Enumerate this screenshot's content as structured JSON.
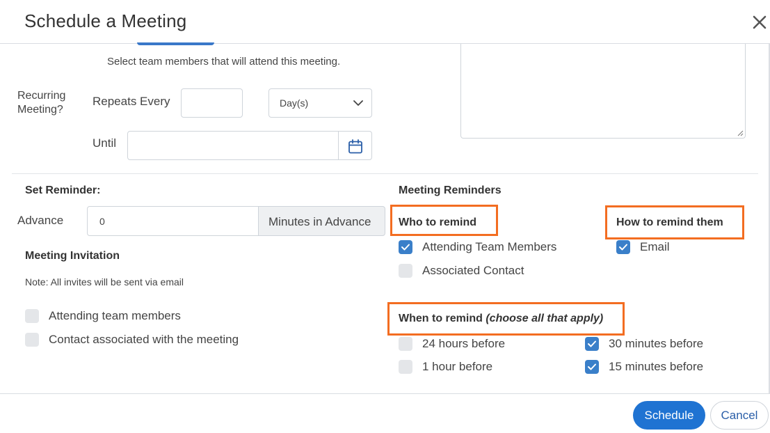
{
  "dialog": {
    "title": "Schedule a Meeting"
  },
  "attendees": {
    "hint": "Select team members that will attend this meeting."
  },
  "recurring": {
    "label": "Recurring Meeting?",
    "label_line1": "Recurring",
    "label_line2": "Meeting?",
    "repeats_label": "Repeats Every",
    "repeats_value": "",
    "unit_value": "Day(s)",
    "until_label": "Until",
    "until_value": ""
  },
  "reminder": {
    "title": "Set Reminder:",
    "advance_label": "Advance",
    "advance_value": "0",
    "advance_unit": "Minutes in Advance"
  },
  "invitation": {
    "title": "Meeting Invitation",
    "note": "Note: All invites will be sent via email",
    "options": [
      {
        "label": "Attending team members",
        "checked": false
      },
      {
        "label": "Contact associated with the meeting",
        "checked": false
      }
    ]
  },
  "meeting_reminders": {
    "title": "Meeting Reminders",
    "who_label": "Who to remind",
    "who_options": [
      {
        "label": "Attending Team Members",
        "checked": true
      },
      {
        "label": "Associated Contact",
        "checked": false
      }
    ],
    "how_label": "How to remind them",
    "how_options": [
      {
        "label": "Email",
        "checked": true
      }
    ],
    "when_label": "When to remind",
    "when_hint": "(choose all that apply)",
    "when_options": [
      {
        "label": "24 hours before",
        "checked": false
      },
      {
        "label": "1 hour before",
        "checked": false
      },
      {
        "label": "30 minutes before",
        "checked": true
      },
      {
        "label": "15 minutes before",
        "checked": true
      }
    ]
  },
  "footer": {
    "schedule_label": "Schedule",
    "cancel_label": "Cancel"
  },
  "colors": {
    "primary": "#1f73d2",
    "checkbox_checked": "#3a7fc9",
    "highlight": "#f36d21"
  },
  "icons": {
    "close": "close-icon",
    "calendar": "calendar-icon",
    "dropdown": "chevron-down-icon",
    "check": "checkmark-icon"
  }
}
